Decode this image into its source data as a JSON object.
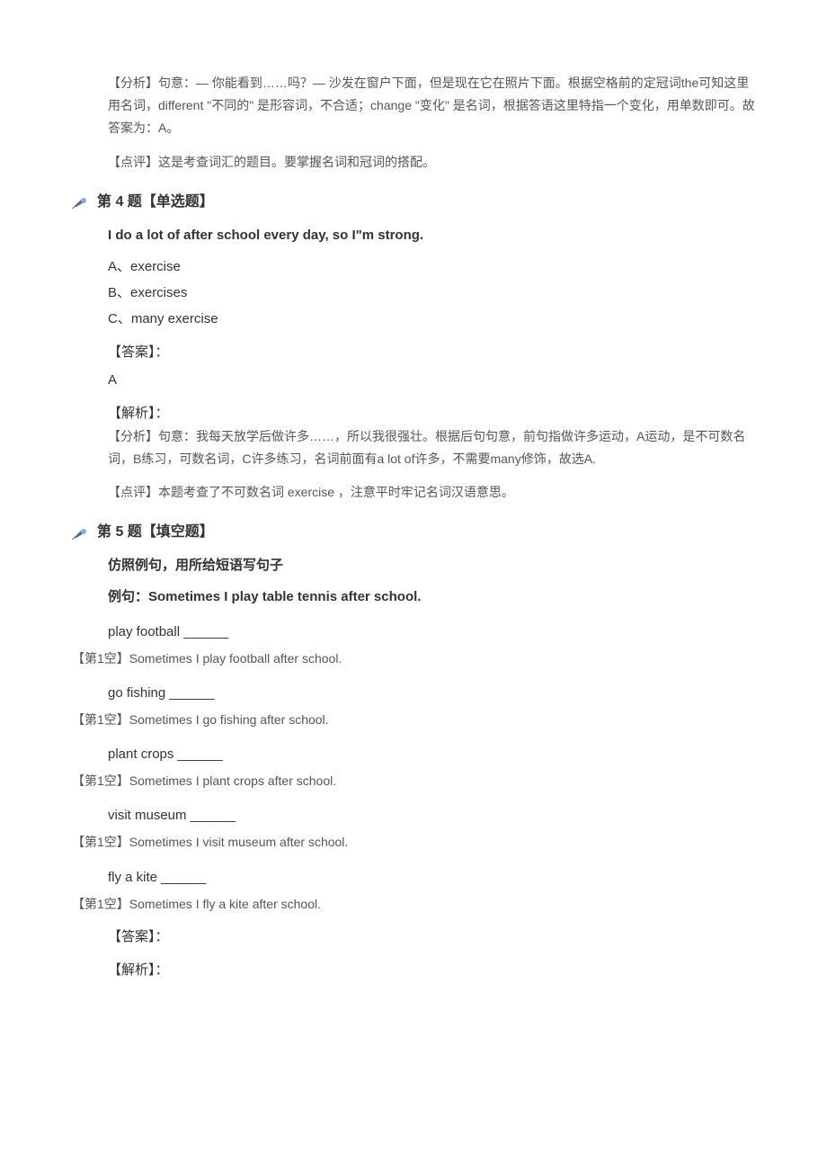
{
  "q3_tail": {
    "analysis": "【分析】句意：— 你能看到……吗？— 沙发在窗户下面，但是现在它在照片下面。根据空格前的定冠词the可知这里用名词，different \"不同的\" 是形容词，不合适；change \"变化\" 是名词，根据答语这里特指一个变化，用单数即可。故答案为：A。",
    "comment": "【点评】这是考查词汇的题目。要掌握名词和冠词的搭配。"
  },
  "q4": {
    "header": "第 4 题【单选题】",
    "stem": "I do a lot of after school every day, so I\"m strong.",
    "optA": "A、exercise",
    "optB": "B、exercises",
    "optC": "C、many exercise",
    "answer_label": "【答案】：",
    "answer_val": "A",
    "jiexi_label": "【解析】：",
    "analysis": "【分析】句意：我每天放学后做许多……，所以我很强壮。根据后句句意，前句指做许多运动，A运动，是不可数名词，B练习，可数名词，C许多练习，名词前面有a lot of许多，不需要many修饰，故选A.",
    "comment": "【点评】本题考查了不可数名词 exercise  ，注意平时牢记名词汉语意思。"
  },
  "q5": {
    "header": "第 5 题【填空题】",
    "intro": "仿照例句，用所给短语写句子",
    "example_label": "例句：",
    "example_text": "Sometimes I play table tennis after school.",
    "items": [
      {
        "prompt": "play football ______",
        "ans": "【第1空】Sometimes I play football after school."
      },
      {
        "prompt": "go fishing ______",
        "ans": "【第1空】Sometimes I go fishing after school."
      },
      {
        "prompt": "plant crops ______",
        "ans": "【第1空】Sometimes I plant crops after school."
      },
      {
        "prompt": "visit museum ______",
        "ans": "【第1空】Sometimes I visit museum after school."
      },
      {
        "prompt": "fly a kite ______",
        "ans": "【第1空】Sometimes I fly a kite after school."
      }
    ],
    "answer_label": "【答案】：",
    "jiexi_label": "【解析】："
  }
}
